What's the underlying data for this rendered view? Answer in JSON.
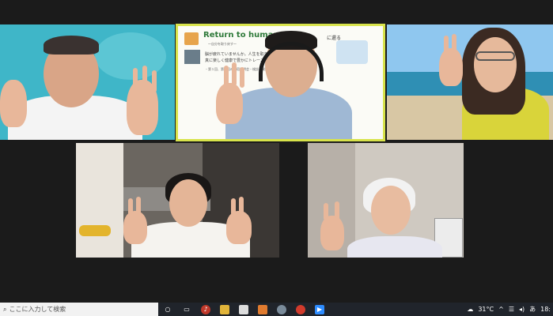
{
  "slide": {
    "title": "Return to human",
    "subtitle": "〜自分を取り戻す〜",
    "line1": "脳が疲れていませんか。人生を取り戻す",
    "line2": "真に楽しく健康で豊かにトレーニング！",
    "line3": "・第１回、第２回の合宿説明会・検診・質問のお問合せ",
    "badge": "に還る"
  },
  "taskbar": {
    "search_placeholder": "ここに入力して検索",
    "weather": "31°C",
    "ime": "あ",
    "clock": "18:"
  },
  "colors": {
    "active_speaker_border": "#d8e34b",
    "taskbar": "#20242b"
  }
}
